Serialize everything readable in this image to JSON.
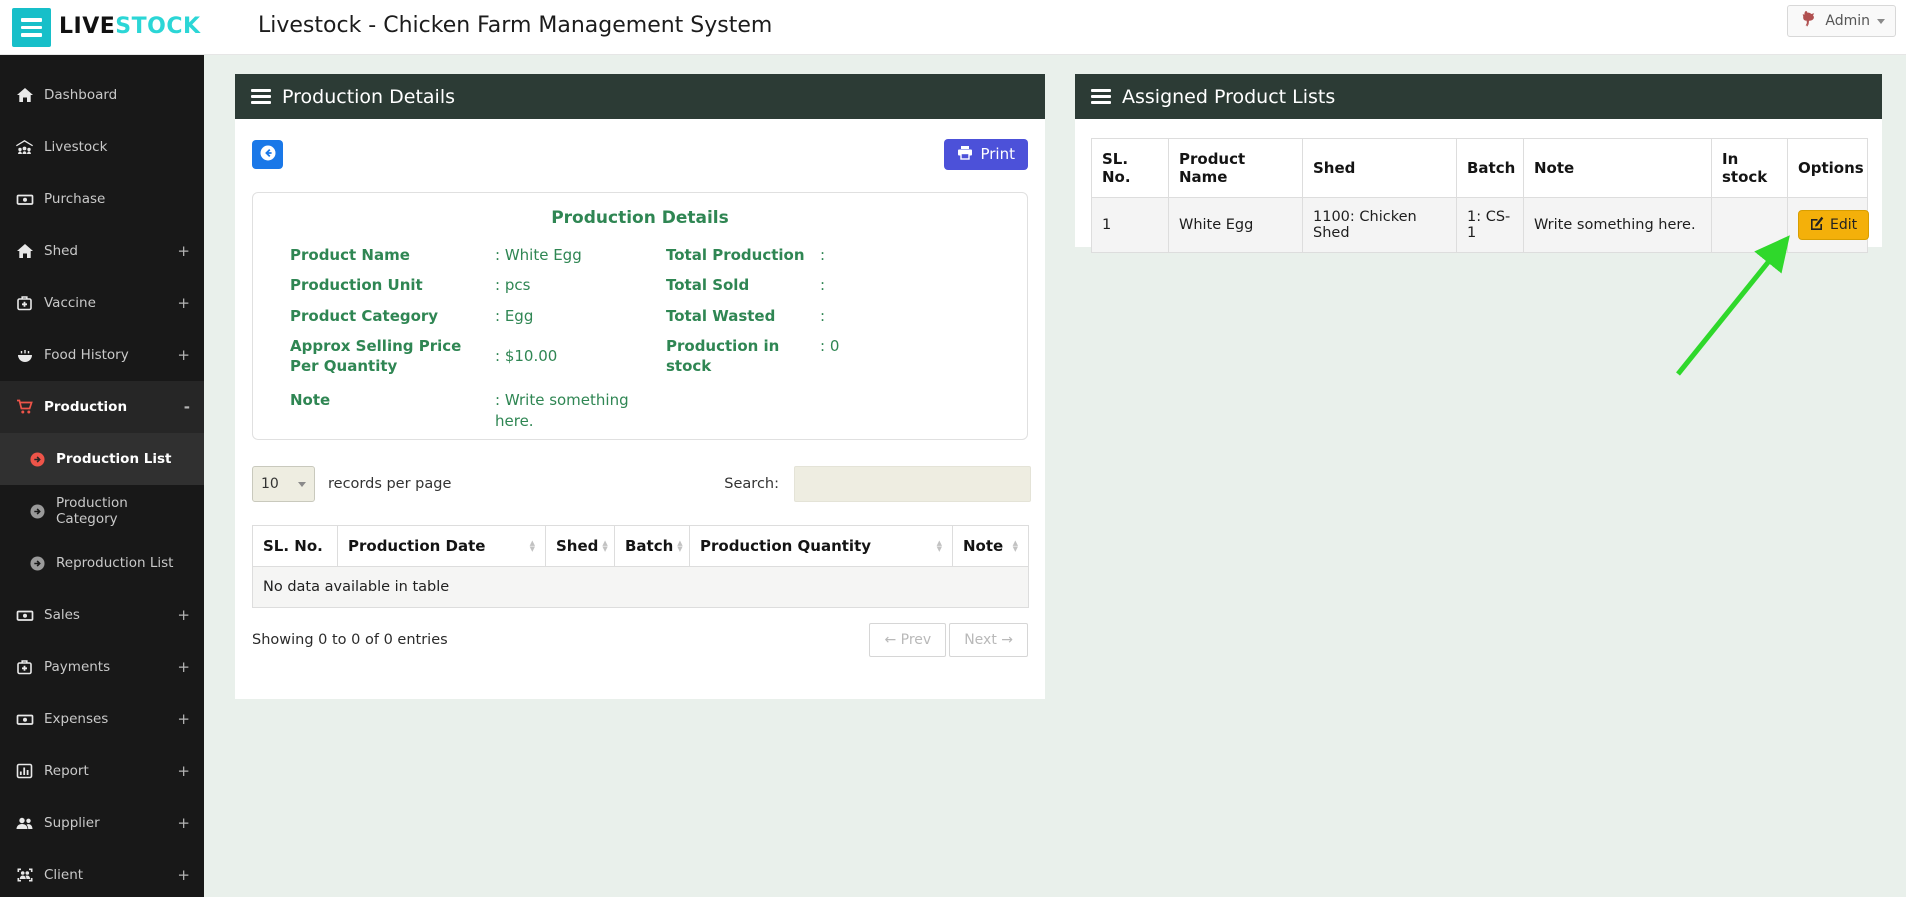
{
  "topbar": {
    "brand_live": "LIVE",
    "brand_stock": "STOCK",
    "title": "Livestock - Chicken Farm Management System",
    "user": "Admin"
  },
  "sidebar": {
    "items": [
      {
        "label": "Dashboard",
        "icon": "home-icon",
        "expand": ""
      },
      {
        "label": "Livestock",
        "icon": "barn-icon",
        "expand": ""
      },
      {
        "label": "Purchase",
        "icon": "money-icon",
        "expand": ""
      },
      {
        "label": "Shed",
        "icon": "home-icon",
        "expand": "+"
      },
      {
        "label": "Vaccine",
        "icon": "medkit-icon",
        "expand": "+"
      },
      {
        "label": "Food History",
        "icon": "bowl-icon",
        "expand": "+"
      },
      {
        "label": "Production",
        "icon": "cart-icon",
        "expand": "-",
        "active": true
      },
      {
        "label": "Production List",
        "icon": "circle-arrow-icon",
        "sub": true,
        "active": true
      },
      {
        "label": "Production Category",
        "icon": "circle-arrow-icon",
        "sub": true
      },
      {
        "label": "Reproduction List",
        "icon": "circle-arrow-icon",
        "sub": true
      },
      {
        "label": "Sales",
        "icon": "money-icon",
        "expand": "+"
      },
      {
        "label": "Payments",
        "icon": "medkit-icon",
        "expand": "+"
      },
      {
        "label": "Expenses",
        "icon": "money-icon",
        "expand": "+"
      },
      {
        "label": "Report",
        "icon": "chart-icon",
        "expand": "+"
      },
      {
        "label": "Supplier",
        "icon": "users-icon",
        "expand": "+"
      },
      {
        "label": "Client",
        "icon": "client-icon",
        "expand": "+"
      }
    ]
  },
  "production_panel": {
    "header": "Production Details",
    "print_label": "Print",
    "details": {
      "title": "Production Details",
      "left": [
        {
          "label": "Product Name",
          "value": ": White Egg"
        },
        {
          "label": "Production Unit",
          "value": ": pcs"
        },
        {
          "label": "Product Category",
          "value": ": Egg"
        },
        {
          "label": "Approx Selling Price Per Quantity",
          "value": ": $10.00"
        },
        {
          "label": "Note",
          "value": ": Write something here."
        }
      ],
      "right": [
        {
          "label": "Total Production",
          "value": ":"
        },
        {
          "label": "Total Sold",
          "value": ":"
        },
        {
          "label": "Total Wasted",
          "value": ":"
        },
        {
          "label": "Production in stock",
          "value": ": 0"
        }
      ]
    },
    "controls": {
      "page_size": "10",
      "records_label": "records per page",
      "search_label": "Search:",
      "search_value": ""
    },
    "table": {
      "headers": [
        "SL. No.",
        "Production Date",
        "Shed",
        "Batch",
        "Production Quantity",
        "Note"
      ],
      "empty_message": "No data available in table"
    },
    "footer": {
      "showing": "Showing 0 to 0 of 0 entries",
      "prev": "← Prev",
      "next": "Next →"
    }
  },
  "assigned_panel": {
    "header": "Assigned Product Lists",
    "table": {
      "headers": [
        "SL. No.",
        "Product Name",
        "Shed",
        "Batch",
        "Note",
        "In stock",
        "Options"
      ],
      "rows": [
        {
          "sl": "1",
          "product": "White Egg",
          "shed": "1100: Chicken Shed",
          "batch": "1: CS-1",
          "note": "Write something here.",
          "in_stock": "",
          "edit_label": "Edit"
        }
      ]
    }
  },
  "icons": {
    "menu-icon": "three-bars",
    "rooster-icon": "red rooster logo glyph",
    "home-icon": "house",
    "barn-icon": "barn with animals",
    "money-icon": "banknote",
    "medkit-icon": "medical kit",
    "bowl-icon": "food bowl",
    "cart-icon": "shopping cart",
    "circle-arrow-icon": "arrow in circle",
    "chart-icon": "bar chart",
    "users-icon": "group of people",
    "client-icon": "people in brackets",
    "printer-icon": "printer",
    "back-icon": "left arrow in circle",
    "edit-icon": "pencil on square",
    "sort-icon": "up-down triangles"
  },
  "colors": {
    "accent_cyan": "#17bfc9",
    "sidebar_bg": "#181818",
    "sidebar_active_red": "#ee5449",
    "panel_header_green": "#2c3b35",
    "detail_text_green": "#2f8653",
    "print_indigo": "#4c51d9",
    "back_blue": "#1a78e8",
    "edit_yellow": "#f4b00a",
    "arrow_green": "#2fd82b",
    "input_beige": "#eeede1",
    "page_bg": "#e9f0eb"
  }
}
